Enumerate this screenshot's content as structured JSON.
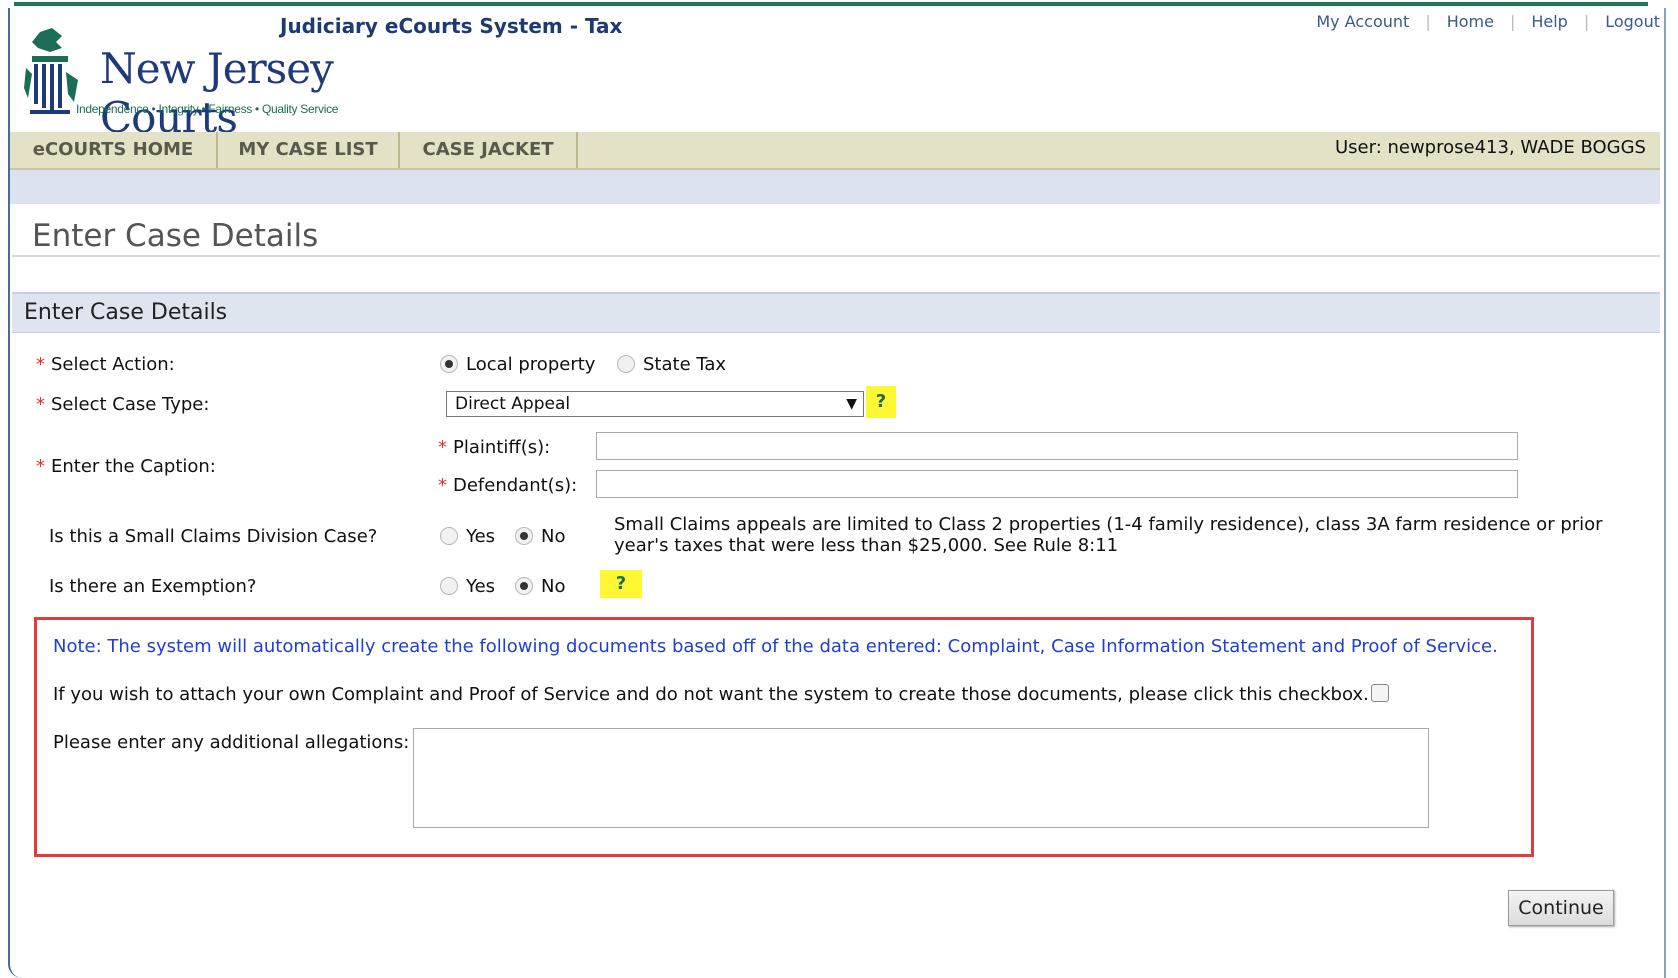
{
  "header": {
    "app_title": "Judiciary eCourts System - Tax",
    "links": [
      "My Account",
      "Home",
      "Help",
      "Logout"
    ],
    "logo_title": "New Jersey Courts",
    "logo_tagline": "Independence • Integrity • Fairness • Quality Service"
  },
  "nav": {
    "items": [
      "eCOURTS HOME",
      "MY CASE LIST",
      "CASE JACKET"
    ],
    "user": "User: newprose413, WADE BOGGS"
  },
  "page": {
    "heading": "Enter Case Details",
    "section_title": "Enter Case Details"
  },
  "form": {
    "select_action": {
      "label": "Select Action:",
      "options": [
        "Local property",
        "State Tax"
      ],
      "selected": "Local property"
    },
    "case_type": {
      "label": "Select Case Type:",
      "value": "Direct Appeal",
      "help": "?"
    },
    "caption": {
      "label": "Enter the Caption:",
      "plaintiff_label": "Plaintiff(s):",
      "plaintiff_value": "",
      "defendant_label": "Defendant(s):",
      "defendant_value": ""
    },
    "small_claims": {
      "label": "Is this a Small Claims Division Case?",
      "options": [
        "Yes",
        "No"
      ],
      "selected": "No",
      "info_line1": "Small Claims appeals are limited to Class 2 properties (1-4 family residence), class 3A farm residence or prior",
      "info_line2": "year's taxes that were less than $25,000. See Rule 8:11"
    },
    "exemption": {
      "label": "Is there an Exemption?",
      "options": [
        "Yes",
        "No"
      ],
      "selected": "No",
      "help": "?"
    },
    "required_mark": "*"
  },
  "note": {
    "text": "Note: The system will automatically create the following documents based off of the data entered: Complaint, Case Information Statement and Proof of Service.",
    "checkbox_text": "If you wish to attach your own Complaint and Proof of Service and do not want the system to create those documents, please click this checkbox.",
    "checkbox_checked": false,
    "allegations_label": "Please enter any additional allegations:",
    "allegations_value": ""
  },
  "actions": {
    "continue_label": "Continue"
  },
  "colors": {
    "nav_bg": "#e3e1c6",
    "section_bg": "#dfe5ee",
    "note_border": "#e03c3c",
    "note_text": "#1f3fd0",
    "help_bg": "#fff733"
  }
}
